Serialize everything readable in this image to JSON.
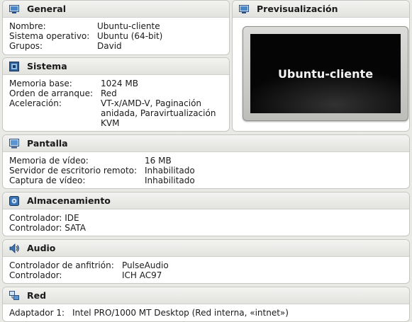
{
  "general": {
    "title": "General",
    "rows": [
      {
        "k": "Nombre:",
        "v": "Ubuntu-cliente"
      },
      {
        "k": "Sistema operativo:",
        "v": "Ubuntu (64-bit)"
      },
      {
        "k": "Grupos:",
        "v": "David"
      }
    ]
  },
  "preview": {
    "title": "Previsualización",
    "vm_name": "Ubuntu-cliente"
  },
  "sistema": {
    "title": "Sistema",
    "rows": [
      {
        "k": "Memoria base:",
        "v": "1024 MB"
      },
      {
        "k": "Orden de arranque:",
        "v": "Red"
      },
      {
        "k": "Aceleración:",
        "v": "VT-x/AMD-V, Paginación anidada, Paravirtualización KVM"
      }
    ]
  },
  "pantalla": {
    "title": "Pantalla",
    "rows": [
      {
        "k": "Memoria de vídeo:",
        "v": "16 MB"
      },
      {
        "k": "Servidor de escritorio remoto:",
        "v": "Inhabilitado"
      },
      {
        "k": "Captura de vídeo:",
        "v": "Inhabilitado"
      }
    ]
  },
  "almacenamiento": {
    "title": "Almacenamiento",
    "rows": [
      {
        "k": "Controlador: IDE",
        "v": ""
      },
      {
        "k": "Controlador: SATA",
        "v": ""
      }
    ]
  },
  "audio": {
    "title": "Audio",
    "rows": [
      {
        "k": "Controlador de anfitrión:",
        "v": "PulseAudio"
      },
      {
        "k": "Controlador:",
        "v": "ICH AC97"
      }
    ]
  },
  "red": {
    "title": "Red",
    "rows": [
      {
        "k": "Adaptador 1:",
        "v": "Intel PRO/1000 MT Desktop (Red interna, «intnet»)"
      }
    ]
  }
}
